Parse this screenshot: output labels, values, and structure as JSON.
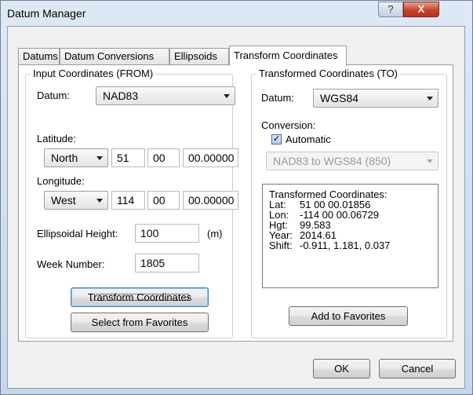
{
  "window": {
    "title": "Datum Manager",
    "help_glyph": "?",
    "close_glyph": "X"
  },
  "tabs": [
    "Datums",
    "Datum Conversions",
    "Ellipsoids",
    "Transform Coordinates"
  ],
  "input": {
    "group_label": "Input Coordinates (FROM)",
    "datum_label": "Datum:",
    "datum_value": "NAD83",
    "latitude_label": "Latitude:",
    "lat_hemisphere": "North",
    "lat_deg": "51",
    "lat_min": "00",
    "lat_sec": "00.00000",
    "longitude_label": "Longitude:",
    "lon_hemisphere": "West",
    "lon_deg": "114",
    "lon_min": "00",
    "lon_sec": "00.00000",
    "height_label": "Ellipsoidal Height:",
    "height_value": "100",
    "height_unit": "(m)",
    "week_label": "Week Number:",
    "week_value": "1805",
    "transform_button": "Transform Coordinates",
    "favorites_button": "Select from Favorites"
  },
  "output": {
    "group_label": "Transformed Coordinates (TO)",
    "datum_label": "Datum:",
    "datum_value": "WGS84",
    "conversion_label": "Conversion:",
    "automatic_label": "Automatic",
    "automatic_checked": true,
    "conversion_value": "NAD83 to WGS84 (850)",
    "result_title": "Transformed Coordinates:",
    "results": [
      {
        "key": "Lat:",
        "value": "51 00 00.01856"
      },
      {
        "key": "Lon:",
        "value": "-114 00 00.06729"
      },
      {
        "key": "Hgt:",
        "value": "99.583"
      },
      {
        "key": "Year:",
        "value": "2014.61"
      },
      {
        "key": "Shift:",
        "value": "-0.911, 1.181, 0.037"
      }
    ],
    "add_favorites_button": "Add to Favorites"
  },
  "footer": {
    "ok": "OK",
    "cancel": "Cancel"
  },
  "colors": {
    "window_frame": "#c7d6e9",
    "close_button": "#c7432a",
    "default_border": "#3c7fb1"
  },
  "icons": {
    "check": "checkmark-icon",
    "dropdown": "chevron-down-icon",
    "help": "help-icon",
    "close": "close-icon"
  }
}
